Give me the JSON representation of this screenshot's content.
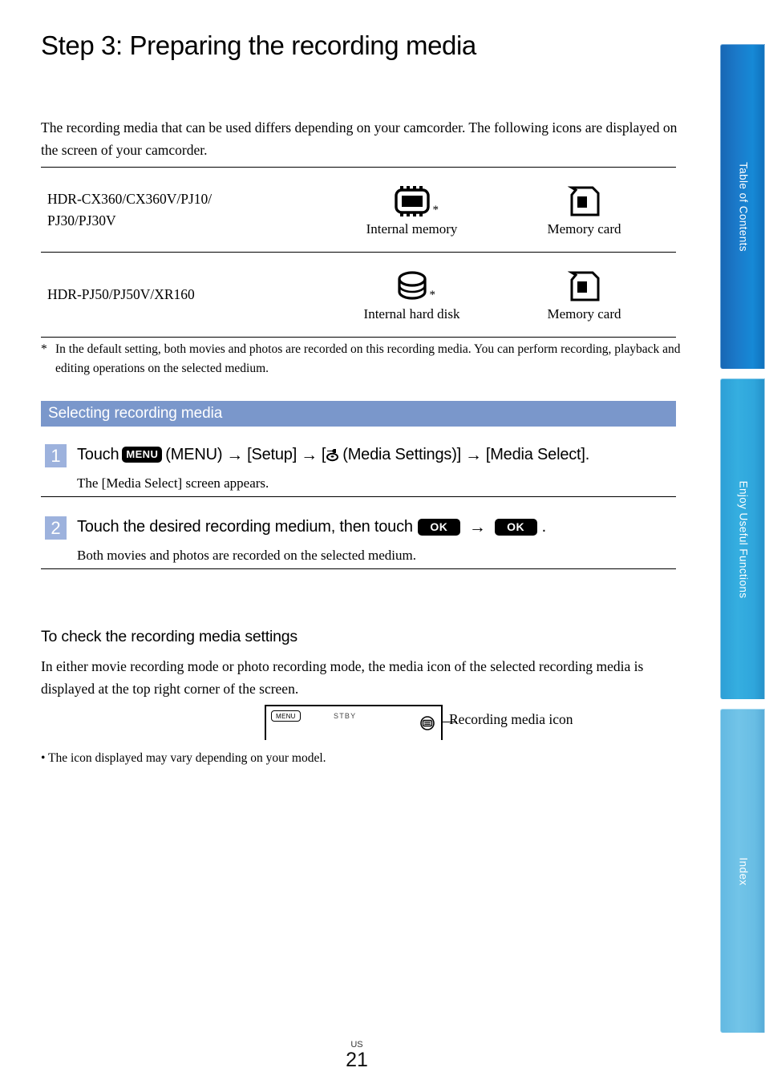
{
  "page": {
    "title": "Step 3: Preparing the recording media",
    "intro": "The recording media that can be used differs depending on your camcorder. The following icons are displayed on the screen of your camcorder.",
    "footer_region": "US",
    "footer_page": "21"
  },
  "media_table": {
    "rows": [
      {
        "models": "HDR-CX360/CX360V/PJ10/PJ30/PJ30V",
        "cells": [
          {
            "icon": "internal-memory-chip-icon",
            "caption": "Internal memory",
            "asterisk": "*"
          },
          {
            "icon": "memory-card-icon",
            "caption": "Memory card",
            "asterisk": ""
          }
        ]
      },
      {
        "models": "HDR-PJ50/PJ50V/XR160",
        "cells": [
          {
            "icon": "internal-hard-disk-icon",
            "caption": "Internal hard disk",
            "asterisk": "*"
          },
          {
            "icon": "memory-card-icon",
            "caption": "Memory card",
            "asterisk": ""
          }
        ]
      }
    ],
    "footnote_mark": "*",
    "footnote": "In the default setting, both movies and photos are recorded on this recording media. You can perform recording, playback and editing operations on the selected medium."
  },
  "section": {
    "banner": "Selecting recording media",
    "steps": [
      {
        "number": "1",
        "head_parts": [
          {
            "type": "text",
            "value": "Touch "
          },
          {
            "type": "badge",
            "value": "MENU"
          },
          {
            "type": "text",
            "value": " (MENU) "
          },
          {
            "type": "arrow",
            "value": "→"
          },
          {
            "type": "text",
            "value": " [Setup] "
          },
          {
            "type": "arrow",
            "value": "→"
          },
          {
            "type": "text",
            "value": " ["
          },
          {
            "type": "glyph",
            "value": "media-settings-icon"
          },
          {
            "type": "text",
            "value": " (Media Settings)] "
          },
          {
            "type": "arrow",
            "value": "→"
          },
          {
            "type": "text",
            "value": " [Media Select]."
          }
        ],
        "head_plain": "Touch MENU (MENU) → [Setup] → [ (Media Settings)] → [Media Select].",
        "sub": "The [Media Select] screen appears.",
        "badge_menu": "MENU",
        "text_touch": "Touch ",
        "text_menu_paren": " (MENU) ",
        "text_setup": " [Setup] ",
        "text_media_settings": " (Media Settings)] ",
        "text_open_bracket": " [",
        "text_media_select": " [Media Select]."
      },
      {
        "number": "2",
        "head_plain": "Touch the desired recording medium, then touch OK → OK .",
        "text_lead": "Touch the desired recording medium, then touch ",
        "badge_ok_1": "OK",
        "badge_ok_2": "OK",
        "text_period": ".",
        "sub": "Both movies and photos are recorded on the selected medium."
      }
    ]
  },
  "check_settings": {
    "heading": "To check the recording media settings",
    "body": "In either movie recording mode or photo recording mode, the media icon of the selected recording media is displayed at the top right corner of the screen.",
    "screen": {
      "menu_label": "MENU",
      "status_label": "STBY",
      "media_icon_name": "recording-media-icon"
    },
    "callout": "Recording media icon",
    "bullet": "• The icon displayed may vary depending on your model."
  },
  "side_tabs": [
    {
      "label": "Table of Contents",
      "color": "#1b79c9"
    },
    {
      "label": "Enjoy Useful Functions",
      "color": "#35aee0"
    },
    {
      "label": "Index",
      "color": "#72c4e8"
    }
  ],
  "arrow_glyph": "→"
}
